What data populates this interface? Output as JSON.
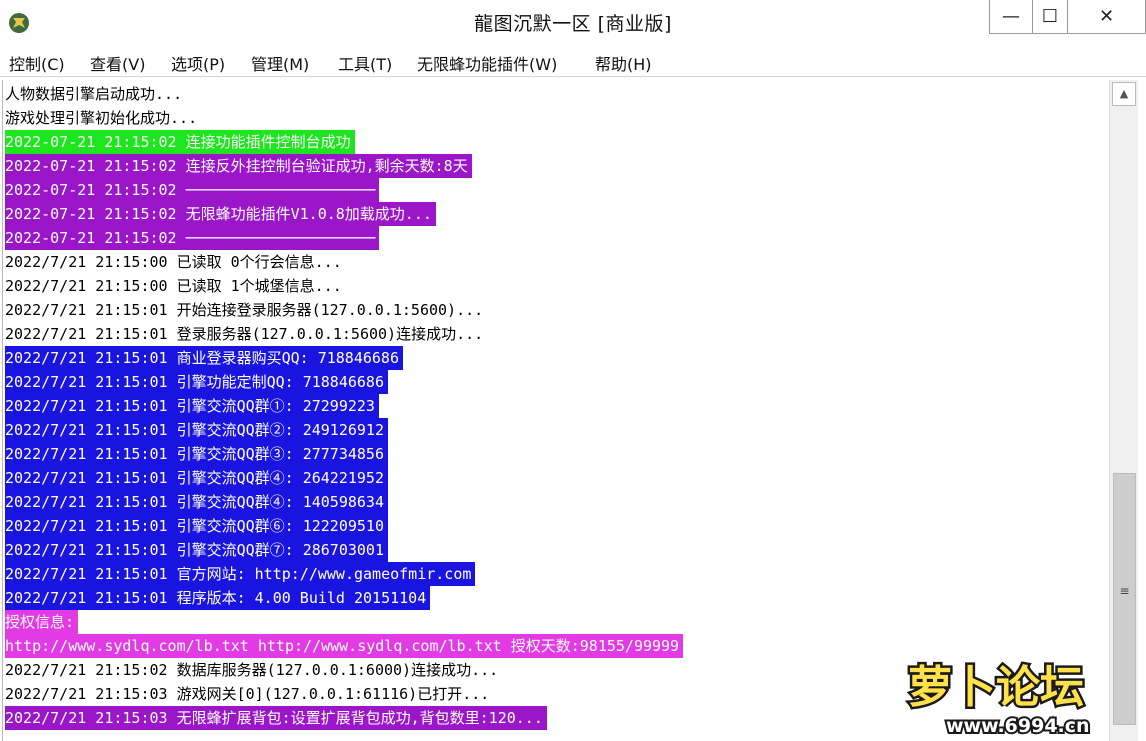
{
  "window": {
    "title": "龍图沉默一区 [商业版]",
    "min_glyph": "—",
    "max_glyph": "☐",
    "close_glyph": "✕"
  },
  "menu": [
    "控制(C)",
    "查看(V)",
    "选项(P)",
    "管理(M)",
    "工具(T)",
    "无限蜂功能插件(W)",
    "帮助(H)"
  ],
  "log": [
    {
      "text": "人物数据引擎启动成功...",
      "bg": "#ffffff",
      "fg": "#000000"
    },
    {
      "text": "游戏处理引擎初始化成功...",
      "bg": "#ffffff",
      "fg": "#000000"
    },
    {
      "text": "2022-07-21 21:15:02 连接功能插件控制台成功",
      "bg": "#1ee61e",
      "fg": "#ffffff"
    },
    {
      "text": "2022-07-21 21:15:02 连接反外挂控制台验证成功,剩余天数:8天",
      "bg": "#9b16c9",
      "fg": "#ffffff"
    },
    {
      "text": "2022-07-21 21:15:02 ─────────────────────",
      "bg": "#9b16c9",
      "fg": "#ffffff"
    },
    {
      "text": "2022-07-21 21:15:02 无限蜂功能插件V1.0.8加载成功...",
      "bg": "#9b16c9",
      "fg": "#ffffff"
    },
    {
      "text": "2022-07-21 21:15:02 ─────────────────────",
      "bg": "#9b16c9",
      "fg": "#ffffff"
    },
    {
      "text": "2022/7/21 21:15:00 已读取 0个行会信息...",
      "bg": "#ffffff",
      "fg": "#000000"
    },
    {
      "text": "2022/7/21 21:15:00 已读取 1个城堡信息...",
      "bg": "#ffffff",
      "fg": "#000000"
    },
    {
      "text": "2022/7/21 21:15:01 开始连接登录服务器(127.0.0.1:5600)...",
      "bg": "#ffffff",
      "fg": "#000000"
    },
    {
      "text": "2022/7/21 21:15:01 登录服务器(127.0.0.1:5600)连接成功...",
      "bg": "#ffffff",
      "fg": "#000000"
    },
    {
      "text": "2022/7/21 21:15:01 商业登录器购买QQ: 718846686",
      "bg": "#1a14e0",
      "fg": "#ffffff"
    },
    {
      "text": "2022/7/21 21:15:01 引擎功能定制QQ: 718846686",
      "bg": "#1a14e0",
      "fg": "#ffffff"
    },
    {
      "text": "2022/7/21 21:15:01 引擎交流QQ群①: 27299223",
      "bg": "#1a14e0",
      "fg": "#ffffff"
    },
    {
      "text": "2022/7/21 21:15:01 引擎交流QQ群②: 249126912",
      "bg": "#1a14e0",
      "fg": "#ffffff"
    },
    {
      "text": "2022/7/21 21:15:01 引擎交流QQ群③: 277734856",
      "bg": "#1a14e0",
      "fg": "#ffffff"
    },
    {
      "text": "2022/7/21 21:15:01 引擎交流QQ群④: 264221952",
      "bg": "#1a14e0",
      "fg": "#ffffff"
    },
    {
      "text": "2022/7/21 21:15:01 引擎交流QQ群④: 140598634",
      "bg": "#1a14e0",
      "fg": "#ffffff"
    },
    {
      "text": "2022/7/21 21:15:01 引擎交流QQ群⑥: 122209510",
      "bg": "#1a14e0",
      "fg": "#ffffff"
    },
    {
      "text": "2022/7/21 21:15:01 引擎交流QQ群⑦: 286703001",
      "bg": "#1a14e0",
      "fg": "#ffffff"
    },
    {
      "text": "2022/7/21 21:15:01 官方网站: http://www.gameofmir.com",
      "bg": "#1a14e0",
      "fg": "#ffffff"
    },
    {
      "text": "2022/7/21 21:15:01 程序版本: 4.00 Build 20151104",
      "bg": "#1a14e0",
      "fg": "#ffffff"
    },
    {
      "text": "授权信息:",
      "bg": "#e23be6",
      "fg": "#ffffff"
    },
    {
      "text": "http://www.sydlq.com/lb.txt http://www.sydlq.com/lb.txt 授权天数:98155/99999",
      "bg": "#e23be6",
      "fg": "#ffffff"
    },
    {
      "text": "2022/7/21 21:15:02 数据库服务器(127.0.0.1:6000)连接成功...",
      "bg": "#ffffff",
      "fg": "#000000"
    },
    {
      "text": "2022/7/21 21:15:03 游戏网关[0](127.0.0.1:61116)已打开...",
      "bg": "#ffffff",
      "fg": "#000000"
    },
    {
      "text": "2022/7/21 21:15:03 无限蜂扩展背包:设置扩展背包成功,背包数里:120...",
      "bg": "#9b16c9",
      "fg": "#ffffff"
    }
  ],
  "scrollbar": {
    "up_glyph": "▲",
    "grip_glyph": "≡"
  },
  "watermark": {
    "text": "萝卜论坛",
    "url": "www.6994.cn"
  }
}
